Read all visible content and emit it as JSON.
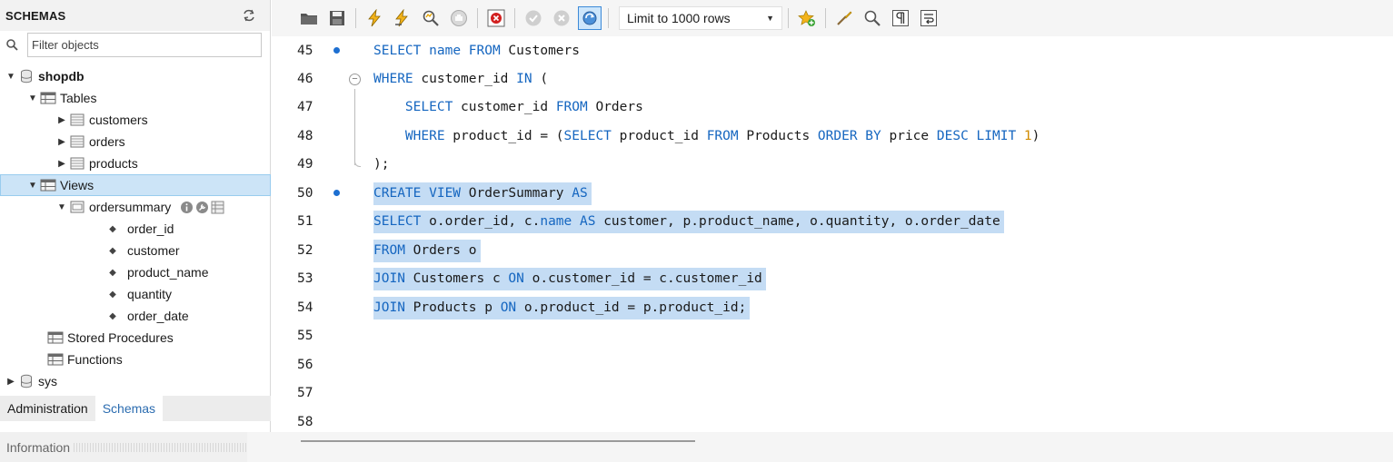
{
  "sidebar": {
    "title": "SCHEMAS",
    "filter_placeholder": "Filter objects",
    "tree": {
      "schema": "shopdb",
      "tables_label": "Tables",
      "tables": [
        "customers",
        "orders",
        "products"
      ],
      "views_label": "Views",
      "view_name": "ordersummary",
      "view_columns": [
        "order_id",
        "customer",
        "product_name",
        "quantity",
        "order_date"
      ],
      "stored_procedures_label": "Stored Procedures",
      "functions_label": "Functions",
      "other_schema": "sys"
    },
    "tabs": [
      "Administration",
      "Schemas"
    ],
    "info_label": "Information"
  },
  "toolbar": {
    "limit_label": "Limit to 1000 rows"
  },
  "editor": {
    "line_numbers": [
      "45",
      "46",
      "47",
      "48",
      "49",
      "50",
      "51",
      "52",
      "53",
      "54",
      "55",
      "56",
      "57",
      "58"
    ],
    "lines": {
      "l45": [
        "SELECT",
        " ",
        "name",
        " ",
        "FROM",
        " Customers"
      ],
      "l46": [
        "WHERE",
        " customer_id ",
        "IN",
        " ("
      ],
      "l47": [
        "    ",
        "SELECT",
        " customer_id ",
        "FROM",
        " Orders"
      ],
      "l48": [
        "    ",
        "WHERE",
        " product_id = (",
        "SELECT",
        " product_id ",
        "FROM",
        " Products ",
        "ORDER BY",
        " price ",
        "DESC",
        " ",
        "LIMIT",
        " ",
        "1",
        ")"
      ],
      "l49": [
        ");"
      ],
      "l50": [
        "CREATE VIEW",
        " OrderSummary ",
        "AS"
      ],
      "l51": [
        "SELECT",
        " o.order_id, c.",
        "name",
        " ",
        "AS",
        " customer, p.product_name, o.quantity, o.order_date"
      ],
      "l52": [
        "FROM",
        " Orders o"
      ],
      "l53": [
        "JOIN",
        " Customers c ",
        "ON",
        " o.customer_id = c.customer_id"
      ],
      "l54": [
        "JOIN",
        " Products p ",
        "ON",
        " o.product_id = p.product_id;"
      ]
    }
  },
  "colors": {
    "keyword": "#1566c0",
    "number": "#d18b00",
    "selection": "#c4dcf4",
    "tree_selection": "#cce4f7"
  }
}
